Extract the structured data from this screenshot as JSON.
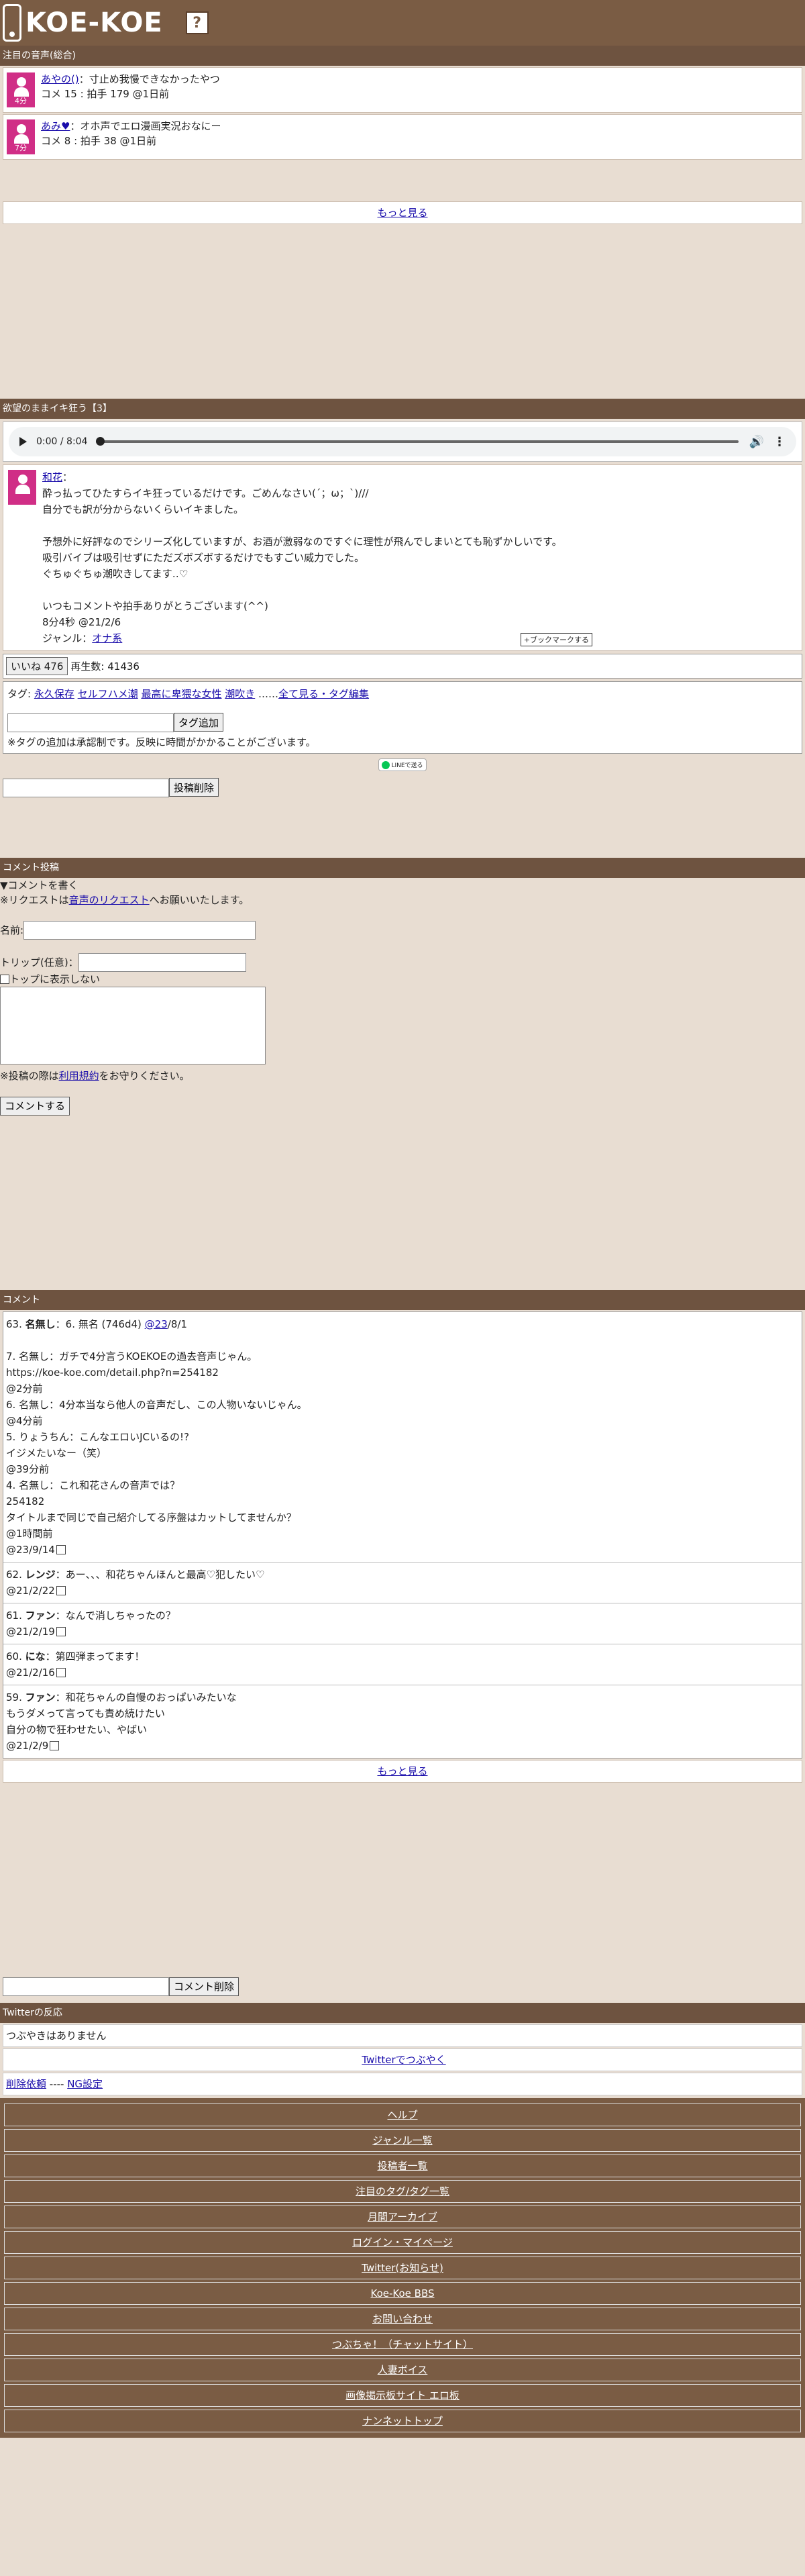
{
  "header": {
    "logo": "KOE-KOE",
    "help": "?"
  },
  "hot": {
    "title": "注目の音声(総合)",
    "items": [
      {
        "length": "4分",
        "user": "あやの()",
        "title": "：寸止め我慢できなかったやつ",
        "meta": "コメ 15 : 拍手 179 @1日前"
      },
      {
        "length": "7分",
        "user": "あみ♥",
        "title": "：オホ声でエロ漫画実況おなにー",
        "meta": "コメ 8 : 拍手 38 @1日前"
      }
    ],
    "more": "もっと見る"
  },
  "voice": {
    "title": "欲望のままイキ狂う【3】",
    "player_time": "0:00 / 8:04",
    "user": "和花",
    "user_suffix": "：",
    "body": "酔っ払ってひたすらイキ狂っているだけです。ごめんなさい(´；ω；`)///\n自分でも訳が分からないくらいイキました。\n\n予想外に好評なのでシリーズ化していますが、お酒が激弱なのですぐに理性が飛んでしまいとても恥ずかしいです。\n吸引バイブは吸引せずにただズボズボするだけでもすごい威力でした。\nぐちゅぐちゅ潮吹きしてます‥♡\n\nいつもコメントや拍手ありがとうございます(^^)\n8分4秒 @21/2/6",
    "genre_label": "ジャンル：",
    "genre": "オナ系",
    "bookmark": "+ブックマークする",
    "like_label": "いいね 476",
    "plays": "再生数: 41436"
  },
  "tags": {
    "label": "タグ:",
    "items": [
      "永久保存",
      "セルフハメ潮",
      "最高に卑猥な女性",
      "潮吹き"
    ],
    "sep": "……",
    "all": "全て見る・タグ編集",
    "add_button": "タグ追加",
    "note": "※タグの追加は承認制です。反映に時間がかかることがございます。"
  },
  "line_share": "LINEで送る",
  "delete_post": "投稿削除",
  "comment_form": {
    "title": "コメント投稿",
    "toggle": "▼コメントを書く",
    "request_note_pre": "※リクエストは",
    "request_link": "音声のリクエスト",
    "request_note_post": "へお願いいたします。",
    "name_label": "名前:",
    "trip_label": "トリップ(任意)：",
    "hide_top": "トップに表示しない",
    "terms_pre": "※投稿の際は",
    "terms_link": "利用規約",
    "terms_post": "をお守りください。",
    "submit": "コメントする"
  },
  "comments": {
    "title": "コメント",
    "items": [
      {
        "num": "63.",
        "name": "名無し",
        "text": "：6. 無名 (746d4) ",
        "link": "@23",
        "tail": "/8/1\n\n7. 名無し：ガチで4分言うKOEKOEの過去音声じゃん。\nhttps://koe-koe.com/detail.php?n=254182\n@2分前\n6. 名無し：4分本当なら他人の音声だし、この人物いないじゃん。\n@4分前\n5. りょうちん：こんなエロいJCいるの!?\nイジメたいなー（笑）\n@39分前\n4. 名無し：これ和花さんの音声では？\n254182\nタイトルまで同じで自己紹介してる序盤はカットしてませんか？\n@1時間前\n@23/9/14"
      },
      {
        "num": "62.",
        "name": "レンジ",
        "text": "：あー、、、和花ちゃんほんと最高♡犯したい♡\n@21/2/22",
        "link": "",
        "tail": ""
      },
      {
        "num": "61.",
        "name": "ファン",
        "text": "：なんで消しちゃったの？\n@21/2/19",
        "link": "",
        "tail": ""
      },
      {
        "num": "60.",
        "name": "にな",
        "text": "：第四弾まってます！\n@21/2/16",
        "link": "",
        "tail": ""
      },
      {
        "num": "59.",
        "name": "ファン",
        "text": "：和花ちゃんの自慢のおっぱいみたいな\nもうダメって言っても責め続けたい\n自分の物で狂わせたい、やばい\n@21/2/9",
        "link": "",
        "tail": ""
      }
    ],
    "more": "もっと見る",
    "delete": "コメント削除"
  },
  "twitter": {
    "title": "Twitterの反応",
    "none": "つぶやきはありません",
    "tweet": "Twitterでつぶやく"
  },
  "misc": {
    "delete_request": "削除依頼",
    "sep": " ---- ",
    "ng": "NG設定"
  },
  "footer": [
    "ヘルプ",
    "ジャンル一覧",
    "投稿者一覧",
    "注目のタグ/タグ一覧",
    "月間アーカイブ",
    "ログイン・マイページ",
    "Twitter(お知らせ)",
    "Koe-Koe BBS",
    "お問い合わせ",
    "つぶちゃ！（チャットサイト）",
    "人妻ボイス",
    "画像掲示板サイト エロ板",
    "ナンネットトップ"
  ]
}
